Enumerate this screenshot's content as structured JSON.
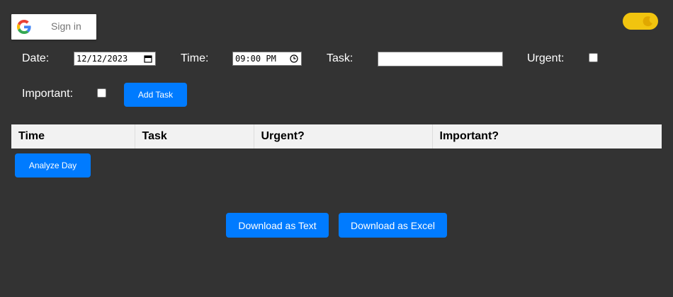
{
  "signin": {
    "label": "Sign in",
    "icon": "google-g-icon"
  },
  "theme_toggle": {
    "icon": "moon-icon",
    "color": "#f1c40f"
  },
  "form": {
    "date_label": "Date:",
    "date_value": "12/12/2023",
    "time_label": "Time:",
    "time_value": "09:00 PM",
    "task_label": "Task:",
    "task_value": "",
    "urgent_label": "Urgent:",
    "urgent_checked": false,
    "important_label": "Important:",
    "important_checked": false,
    "add_button": "Add Task"
  },
  "table": {
    "headers": [
      "Time",
      "Task",
      "Urgent?",
      "Important?"
    ],
    "rows": []
  },
  "analyze_button": "Analyze Day",
  "download": {
    "text_button": "Download as Text",
    "excel_button": "Download as Excel"
  },
  "colors": {
    "background": "#333333",
    "accent": "#007bff",
    "toggle": "#f1c40f",
    "table_header": "#f2f2f2"
  }
}
